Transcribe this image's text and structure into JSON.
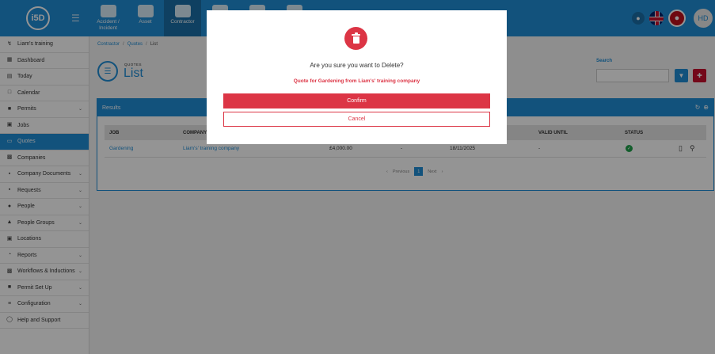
{
  "app": {
    "logo": "i5D",
    "user_initials": "HD"
  },
  "topnav": [
    {
      "label": "Accident / Incident",
      "icon": "medical-bag-icon"
    },
    {
      "label": "Asset",
      "icon": "boxes-icon"
    },
    {
      "label": "Contractor",
      "icon": "hardhat-icon"
    },
    {
      "label": "",
      "icon": "document-icon"
    },
    {
      "label": "",
      "icon": "people-icon"
    },
    {
      "label": "",
      "icon": "helmet-icon"
    }
  ],
  "sidebar": {
    "items": [
      {
        "label": "Liam's training",
        "icon": "branch-icon",
        "chevron": false
      },
      {
        "label": "Dashboard",
        "icon": "dashboard-icon",
        "chevron": false
      },
      {
        "label": "Today",
        "icon": "today-icon",
        "chevron": false
      },
      {
        "label": "Calendar",
        "icon": "calendar-icon",
        "chevron": false
      },
      {
        "label": "Permits",
        "icon": "permits-icon",
        "chevron": true
      },
      {
        "label": "Jobs",
        "icon": "jobs-icon",
        "chevron": false
      },
      {
        "label": "Quotes",
        "icon": "quotes-icon",
        "chevron": false,
        "active": true
      },
      {
        "label": "Companies",
        "icon": "companies-icon",
        "chevron": false
      },
      {
        "label": "Company Documents",
        "icon": "documents-icon",
        "chevron": true
      },
      {
        "label": "Requests",
        "icon": "requests-icon",
        "chevron": true
      },
      {
        "label": "People",
        "icon": "people-icon",
        "chevron": true
      },
      {
        "label": "People Groups",
        "icon": "people-groups-icon",
        "chevron": true
      },
      {
        "label": "Locations",
        "icon": "locations-icon",
        "chevron": false
      },
      {
        "label": "Reports",
        "icon": "reports-icon",
        "chevron": true
      },
      {
        "label": "Workflows & Inductions",
        "icon": "workflows-icon",
        "chevron": true
      },
      {
        "label": "Permit Set Up",
        "icon": "permit-setup-icon",
        "chevron": true
      },
      {
        "label": "Configuration",
        "icon": "configuration-icon",
        "chevron": true
      },
      {
        "label": "Help and Support",
        "icon": "help-icon",
        "chevron": false
      }
    ]
  },
  "breadcrumb": [
    "Contractor",
    "Quotes",
    "List"
  ],
  "page": {
    "subtitle": "QUOTES",
    "title": "List"
  },
  "search": {
    "label": "Search",
    "placeholder": ""
  },
  "results": {
    "title": "Results",
    "columns": [
      "JOB",
      "COMPANY",
      "",
      "",
      "",
      "VALID UNTIL",
      "STATUS"
    ],
    "rows": [
      {
        "job": "Gardening",
        "company": "Liam's' training company",
        "amount": "£4,000.00",
        "dash": "-",
        "date": "18/11/2025",
        "valid_until": "-",
        "status": "approved"
      }
    ],
    "pager": {
      "prev": "Previous",
      "page": "1",
      "next": "Next"
    }
  },
  "modal": {
    "question": "Are you sure you want to Delete?",
    "subject": "Quote for Gardening from Liam's' training company",
    "confirm_label": "Confirm",
    "cancel_label": "Cancel",
    "accent": "#dc3545"
  }
}
